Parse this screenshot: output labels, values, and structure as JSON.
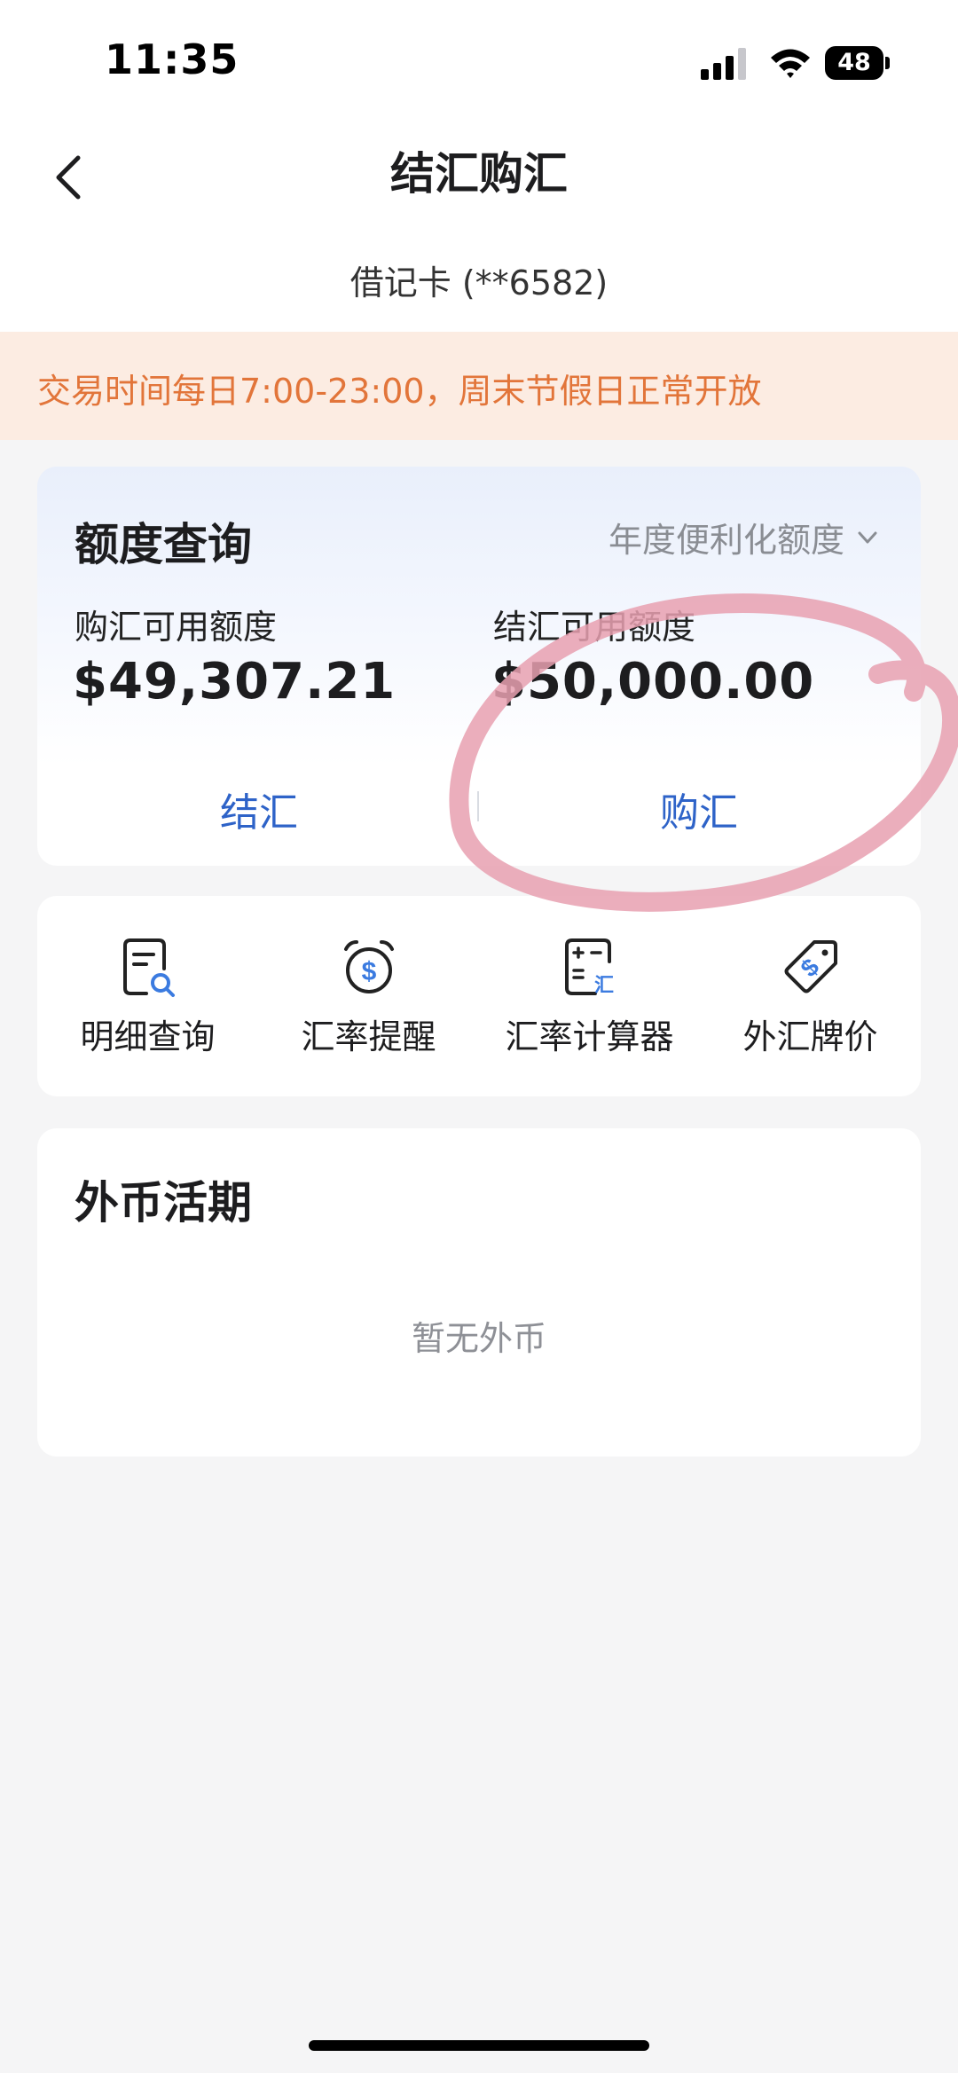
{
  "status_bar": {
    "time": "11:35",
    "battery": "48",
    "icons": [
      "signal-icon",
      "wifi-icon",
      "battery-icon"
    ]
  },
  "nav": {
    "back_icon": "chevron-left-icon",
    "title": "结汇购汇",
    "card_label": "借记卡 (**6582)"
  },
  "notice": {
    "text": "交易时间每日7:00-23:00，周末节假日正常开放",
    "color": "#e2753a"
  },
  "quota": {
    "title": "额度查询",
    "dropdown_label": "年度便利化额度",
    "purchase_label": "购汇可用额度",
    "purchase_value": "$49,307.21",
    "settle_label": "结汇可用额度",
    "settle_value": "$50,000.00",
    "actions": {
      "settle": "结汇",
      "purchase": "购汇"
    }
  },
  "shortcuts": [
    {
      "label": "明细查询",
      "icon": "document-search-icon"
    },
    {
      "label": "汇率提醒",
      "icon": "alarm-dollar-icon"
    },
    {
      "label": "汇率计算器",
      "icon": "calculator-icon"
    },
    {
      "label": "外汇牌价",
      "icon": "price-tag-icon"
    }
  ],
  "fx_account": {
    "title": "外币活期",
    "empty_text": "暂无外币"
  },
  "colors": {
    "accent": "#2e63c8",
    "annotation": "#e8a0b0"
  }
}
